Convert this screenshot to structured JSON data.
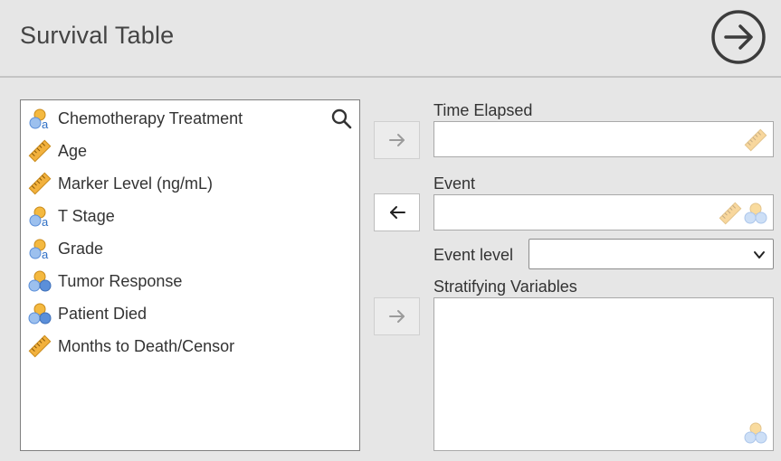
{
  "header": {
    "title": "Survival Table",
    "run_icon": "arrow-circle-right-icon"
  },
  "variables": [
    {
      "label": "Chemotherapy Treatment",
      "type": "nominal-text"
    },
    {
      "label": "Age",
      "type": "continuous"
    },
    {
      "label": "Marker Level (ng/mL)",
      "type": "continuous"
    },
    {
      "label": "T Stage",
      "type": "nominal-text"
    },
    {
      "label": "Grade",
      "type": "nominal-text"
    },
    {
      "label": "Tumor Response",
      "type": "nominal"
    },
    {
      "label": "Patient Died",
      "type": "nominal"
    },
    {
      "label": "Months to Death/Censor",
      "type": "continuous"
    }
  ],
  "fields": {
    "time_elapsed": {
      "label": "Time Elapsed"
    },
    "event": {
      "label": "Event"
    },
    "event_level": {
      "label": "Event level",
      "value": ""
    },
    "stratifying": {
      "label": "Stratifying Variables"
    }
  },
  "colors": {
    "ruler": "#f2b13d",
    "nominal_orange": "#f4b940",
    "nominal_blue": "#5b8fd9",
    "text_a": "#2f6fc4"
  }
}
